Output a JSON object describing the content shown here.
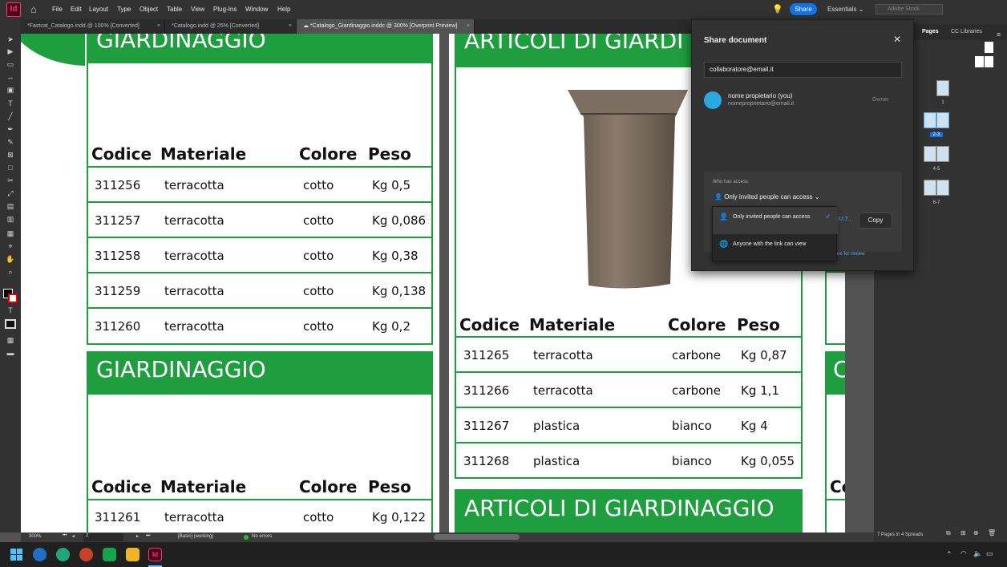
{
  "app": {
    "logo": "Id",
    "menus": [
      "File",
      "Edit",
      "Layout",
      "Type",
      "Object",
      "Table",
      "View",
      "Plug-Ins",
      "Window",
      "Help"
    ],
    "share_button": "Share",
    "workspace": "Essentials",
    "stock_search_placeholder": "Adobe Stock"
  },
  "doc_tabs": [
    {
      "label": "*Fastcat_Catalogo.indd @ 100% [Converted]"
    },
    {
      "label": "*Catalogo.indd @ 25% [Converted]"
    },
    {
      "label": "*Catalogo_Giardinaggio.inddc @ 300% [Overprint Preview]"
    }
  ],
  "catalog": {
    "category_title": "GIARDINAGGIO",
    "articles_title": "ARTICOLI DI GIARDINAGGIO",
    "articles_title_cut": "ARTICOLI DI GIARDI",
    "headers": {
      "code": "Codice",
      "material": "Materiale",
      "color": "Colore",
      "weight": "Peso"
    },
    "table1": [
      {
        "code": "311256",
        "material": "terracotta",
        "color": "cotto",
        "weight": "Kg 0,5"
      },
      {
        "code": "311257",
        "material": "terracotta",
        "color": "cotto",
        "weight": "Kg 0,086"
      },
      {
        "code": "311258",
        "material": "terracotta",
        "color": "cotto",
        "weight": "Kg 0,38"
      },
      {
        "code": "311259",
        "material": "terracotta",
        "color": "cotto",
        "weight": "Kg 0,138"
      },
      {
        "code": "311260",
        "material": "terracotta",
        "color": "cotto",
        "weight": "Kg 0,2"
      }
    ],
    "table2": [
      {
        "code": "311261",
        "material": "terracotta",
        "color": "cotto",
        "weight": "Kg 0,122"
      }
    ],
    "table3": [
      {
        "code": "311265",
        "material": "terracotta",
        "color": "carbone",
        "weight": "Kg 0,87"
      },
      {
        "code": "311266",
        "material": "terracotta",
        "color": "carbone",
        "weight": "Kg 1,1"
      },
      {
        "code": "311267",
        "material": "plastica",
        "color": "bianco",
        "weight": "Kg 4"
      },
      {
        "code": "311268",
        "material": "plastica",
        "color": "bianco",
        "weight": "Kg 0,055"
      }
    ],
    "right_edge_letters": [
      "C",
      "Co"
    ]
  },
  "pages_panel": {
    "tabs": [
      "Pages",
      "CC Libraries"
    ],
    "spreads": [
      "1",
      "2-3",
      "4-5",
      "6-7"
    ],
    "footer": "7 Pages in 4 Spreads"
  },
  "status_bar": {
    "zoom": "300%",
    "page": "2",
    "preflight_profile": "[Basic] (working)",
    "errors": "No errors"
  },
  "share_dialog": {
    "title": "Share document",
    "email_value": "collaboratore@email.it",
    "owner_name": "nome propietario (you)",
    "owner_email": "nomeproprietario@email.it",
    "owner_role": "Owner",
    "who_has_access_label": "Who has access",
    "access_selected": "Only invited people can access",
    "link_fragment": "EU:7...",
    "copy_button": "Copy",
    "review_fragment": "are for review.",
    "options": [
      {
        "label": "Only invited people can access",
        "selected": true
      },
      {
        "label": "Anyone with the link can view",
        "selected": false
      }
    ]
  },
  "colors": {
    "brand_green": "#1e9e3e",
    "share_blue": "#1473e6",
    "indesign": "#ff3366"
  }
}
